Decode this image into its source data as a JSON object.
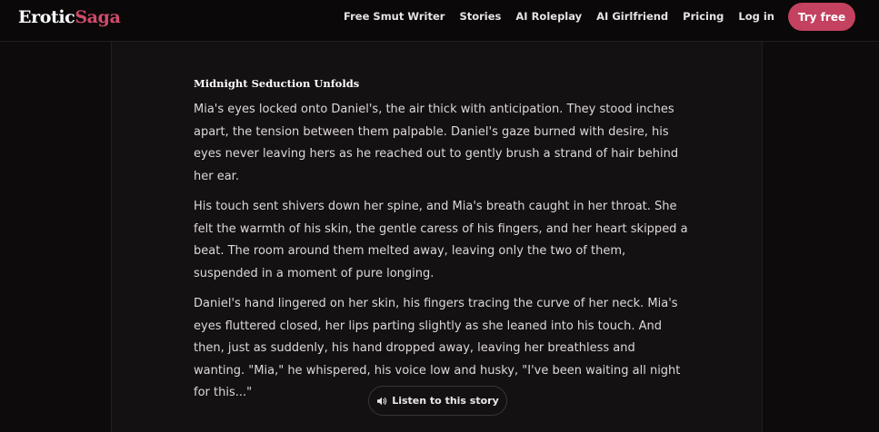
{
  "header": {
    "logo_part1": "Erotic",
    "logo_part2": "Saga",
    "nav": [
      "Free Smut Writer",
      "Stories",
      "AI Roleplay",
      "AI Girlfriend",
      "Pricing",
      "Log in"
    ],
    "cta_label": "Try free"
  },
  "story": {
    "title": "Midnight Seduction Unfolds",
    "paragraphs": [
      "Mia's eyes locked onto Daniel's, the air thick with anticipation. They stood inches apart, the tension between them palpable. Daniel's gaze burned with desire, his eyes never leaving hers as he reached out to gently brush a strand of hair behind her ear.",
      "His touch sent shivers down her spine, and Mia's breath caught in her throat. She felt the warmth of his skin, the gentle caress of his fingers, and her heart skipped a beat. The room around them melted away, leaving only the two of them, suspended in a moment of pure longing.",
      "Daniel's hand lingered on her skin, his fingers tracing the curve of her neck. Mia's eyes fluttered closed, her lips parting slightly as she leaned into his touch. And then, just as suddenly, his hand dropped away, leaving her breathless and wanting. \"Mia,\" he whispered, his voice low and husky, \"I've been waiting all night for this...\""
    ],
    "listen_label": "Listen to this story",
    "listen_icon": "speaker-icon"
  },
  "colors": {
    "accent": "#c4415f",
    "logo_accent": "#d14a6b",
    "background": "#0d0b0c",
    "card": "#141112"
  }
}
